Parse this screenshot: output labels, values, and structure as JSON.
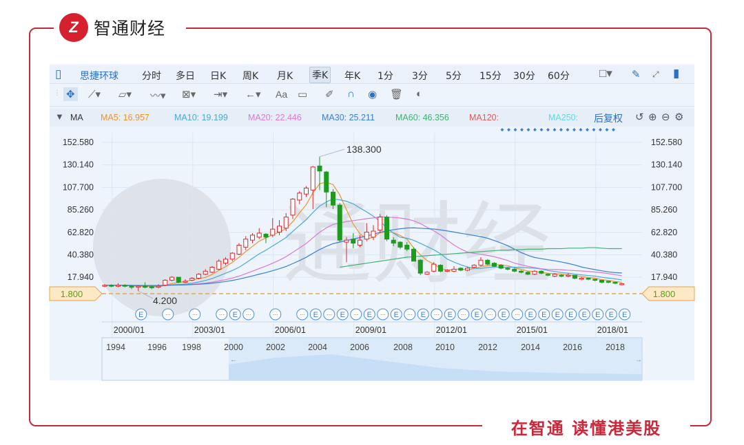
{
  "brand": {
    "logo_mark": "Z",
    "name": "智通财经",
    "slogan": "在智通 读懂港美股",
    "color": "#c8283a"
  },
  "toolbar": {
    "stock_name": "思捷环球",
    "periods": [
      "分时",
      "多日",
      "日K",
      "周K",
      "月K",
      "季K",
      "年K",
      "1分",
      "3分",
      "5分",
      "15分",
      "30分",
      "60分"
    ],
    "selected_period": "季K"
  },
  "drawing_tools": [
    "move-icon",
    "line-icon",
    "polyline-icon",
    "wave-icon",
    "fib-icon",
    "range-icon",
    "arrow-icon",
    "text-icon",
    "comment-icon",
    "pen-icon",
    "magnet-icon",
    "eye-icon",
    "trash-icon",
    "compare-icon"
  ],
  "text_tool_label": "Aa",
  "ma_bar": {
    "label": "MA",
    "items": [
      {
        "text": "MA5: 16.957",
        "color": "#f0932b"
      },
      {
        "text": "MA10: 19.199",
        "color": "#4aa8d8"
      },
      {
        "text": "MA20: 22.446",
        "color": "#d67ad6"
      },
      {
        "text": "MA30: 25.211",
        "color": "#3a7fd5"
      },
      {
        "text": "MA60: 46.356",
        "color": "#3fb26f"
      },
      {
        "text": "MA120:",
        "color": "#e05a5a"
      },
      {
        "text": "MA250:",
        "color": "#5fd8e8"
      }
    ],
    "adjust": "后复权"
  },
  "chart_data": {
    "type": "candlestick",
    "y_ticks": [
      "152.580",
      "130.140",
      "107.700",
      "85.260",
      "62.820",
      "40.380",
      "17.940"
    ],
    "y_tick_values": [
      152.58,
      130.14,
      107.7,
      85.26,
      62.82,
      40.38,
      17.94
    ],
    "current_price": "1.800",
    "max_label": "138.300",
    "max_index": 32,
    "min_label": "4.200",
    "min_index": 5,
    "x_labels": [
      {
        "t": "2000/01",
        "q": 1
      },
      {
        "t": "2003/01",
        "q": 13
      },
      {
        "t": "2006/01",
        "q": 25
      },
      {
        "t": "2009/01",
        "q": 37
      },
      {
        "t": "2012/01",
        "q": 49
      },
      {
        "t": "2015/01",
        "q": 61
      },
      {
        "t": "2018/01",
        "q": 73
      }
    ],
    "navigator_labels": [
      "1994",
      "1996",
      "1998",
      "2000",
      "2002",
      "2004",
      "2006",
      "2008",
      "2010",
      "2012",
      "2014",
      "2016",
      "2018"
    ],
    "candles_ochl": [
      [
        9,
        10,
        11,
        8
      ],
      [
        10,
        9.5,
        11,
        8
      ],
      [
        9.5,
        10,
        12,
        8
      ],
      [
        10,
        9,
        11,
        8
      ],
      [
        9,
        8,
        10,
        6
      ],
      [
        8,
        9,
        10,
        4.2
      ],
      [
        9,
        8.5,
        13,
        7
      ],
      [
        8.5,
        8,
        10,
        6
      ],
      [
        8,
        9,
        11,
        7
      ],
      [
        10,
        15,
        16,
        9
      ],
      [
        15,
        18,
        19,
        14
      ],
      [
        18,
        13,
        18,
        12
      ],
      [
        13,
        14,
        16,
        12
      ],
      [
        15,
        17,
        18,
        14
      ],
      [
        17,
        21,
        22,
        16
      ],
      [
        21,
        24,
        26,
        20
      ],
      [
        23,
        28,
        29,
        22
      ],
      [
        26,
        34,
        36,
        25
      ],
      [
        32,
        36,
        38,
        30
      ],
      [
        36,
        42,
        43,
        34
      ],
      [
        41,
        50,
        52,
        40
      ],
      [
        48,
        56,
        59,
        45
      ],
      [
        55,
        60,
        62,
        52
      ],
      [
        58,
        62,
        67,
        56
      ],
      [
        61,
        58,
        62,
        52
      ],
      [
        60,
        66,
        77,
        58
      ],
      [
        63,
        69,
        75,
        60
      ],
      [
        67,
        78,
        82,
        64
      ],
      [
        80,
        96,
        97,
        76
      ],
      [
        95,
        102,
        104,
        91
      ],
      [
        101,
        107,
        109,
        98
      ],
      [
        105,
        128,
        129,
        86
      ],
      [
        129,
        124,
        138.3,
        105
      ],
      [
        123,
        103,
        124,
        88
      ],
      [
        103,
        90,
        106,
        86
      ],
      [
        90,
        55,
        92,
        53
      ],
      [
        53,
        55,
        58,
        33
      ],
      [
        56,
        52,
        62,
        47
      ],
      [
        50,
        55,
        60,
        48
      ],
      [
        56,
        63,
        72,
        54
      ],
      [
        58,
        64,
        70,
        55
      ],
      [
        65,
        78,
        81,
        62
      ],
      [
        78,
        56,
        80,
        54
      ],
      [
        55,
        52,
        58,
        49
      ],
      [
        53,
        48,
        54,
        46
      ],
      [
        50,
        46,
        53,
        44
      ],
      [
        46,
        34,
        48,
        34
      ],
      [
        35,
        22,
        36,
        20
      ],
      [
        21,
        23,
        24,
        20
      ],
      [
        24,
        31,
        33,
        23
      ],
      [
        30,
        24,
        31,
        23
      ],
      [
        24,
        25,
        26,
        23
      ],
      [
        24,
        26,
        29,
        23
      ],
      [
        27,
        25,
        28,
        24
      ],
      [
        25,
        27,
        28,
        24
      ],
      [
        28,
        30,
        31,
        27
      ],
      [
        30,
        35,
        38,
        29
      ],
      [
        35,
        31,
        36,
        30
      ],
      [
        32,
        29,
        33,
        28
      ],
      [
        30,
        27,
        31,
        26
      ],
      [
        27,
        26,
        28,
        25
      ],
      [
        26,
        24,
        27,
        23
      ],
      [
        24,
        23,
        25,
        22
      ],
      [
        23,
        21,
        24,
        20
      ],
      [
        21,
        24,
        25,
        20
      ],
      [
        24,
        22,
        25,
        21
      ],
      [
        21,
        20,
        22,
        19
      ],
      [
        19,
        21,
        22,
        18
      ],
      [
        20,
        19,
        21,
        18
      ],
      [
        19,
        20,
        22,
        18
      ],
      [
        20,
        17,
        20,
        16
      ],
      [
        16,
        17,
        18,
        15
      ],
      [
        17,
        16,
        17,
        15
      ],
      [
        16,
        15,
        16,
        14
      ],
      [
        15,
        13,
        15,
        12
      ],
      [
        14,
        13,
        14,
        12
      ],
      [
        13,
        12,
        13,
        11
      ],
      [
        11,
        11.5,
        12,
        10
      ]
    ],
    "ma60_start": 35,
    "ma60": [
      28,
      29,
      30,
      31,
      32,
      33,
      34,
      35,
      36,
      37,
      38,
      38.5,
      39,
      39.5,
      40,
      40.5,
      41,
      41.5,
      42,
      42.5,
      43,
      43.5,
      44,
      44.5,
      45,
      45,
      45.5,
      45.5,
      46,
      46,
      46,
      46.5,
      46.5,
      46.5,
      47,
      47,
      47,
      47.5,
      47.5,
      47,
      46.5,
      46.5,
      46.5
    ],
    "events": [
      [
        5,
        "E"
      ],
      [
        9,
        "..."
      ],
      [
        13,
        "..."
      ],
      [
        17,
        "..."
      ],
      [
        19,
        "E"
      ],
      [
        21,
        "..."
      ],
      [
        25,
        "..."
      ],
      [
        29,
        "..."
      ],
      [
        31,
        "E"
      ],
      [
        33,
        "..."
      ],
      [
        35,
        "E"
      ],
      [
        37,
        "..."
      ],
      [
        39,
        "E"
      ],
      [
        41,
        "..."
      ],
      [
        43,
        "E"
      ],
      [
        45,
        "..."
      ],
      [
        47,
        "E"
      ],
      [
        49,
        "..."
      ],
      [
        51,
        "E"
      ],
      [
        53,
        "..."
      ],
      [
        55,
        "E"
      ],
      [
        57,
        "..."
      ],
      [
        59,
        "E"
      ],
      [
        61,
        "..."
      ],
      [
        63,
        "E"
      ],
      [
        65,
        "E"
      ],
      [
        67,
        "E"
      ],
      [
        69,
        "E"
      ],
      [
        71,
        "E"
      ],
      [
        73,
        "E"
      ],
      [
        75,
        "E"
      ],
      [
        77,
        "E"
      ]
    ],
    "up_color": "#e0262b",
    "down_color": "#1e9a1e"
  }
}
